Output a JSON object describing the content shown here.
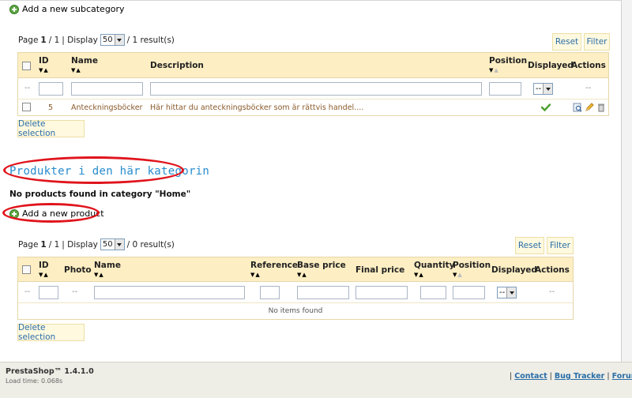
{
  "subcategory": {
    "add_link": "Add a new subcategory",
    "pager": {
      "page_label": "Page",
      "page": "1",
      "of": "/ 1",
      "display_label": "| Display",
      "per_page": "50",
      "results": "/ 1 result(s)"
    },
    "buttons": {
      "reset": "Reset",
      "filter": "Filter",
      "delete": "Delete selection"
    },
    "columns": {
      "id": "ID",
      "name": "Name",
      "description": "Description",
      "position": "Position",
      "displayed": "Displayed",
      "actions": "Actions"
    },
    "filter": {
      "dash": "--",
      "displayed_select": "--"
    },
    "rows": [
      {
        "id": "5",
        "name": "Anteckningsböcker",
        "description": "Här hittar du anteckningsböcker som är rättvis handel...."
      }
    ]
  },
  "products": {
    "section_title": "Produkter i den här kategorin",
    "empty_message": "No products found in category \"Home\"",
    "add_link": "Add a new product",
    "pager": {
      "page_label": "Page",
      "page": "1",
      "of": "/ 1",
      "display_label": "| Display",
      "per_page": "50",
      "results": "/ 0 result(s)"
    },
    "buttons": {
      "reset": "Reset",
      "filter": "Filter",
      "delete": "Delete selection"
    },
    "columns": {
      "id": "ID",
      "photo": "Photo",
      "name": "Name",
      "reference": "Reference",
      "base_price": "Base price",
      "final_price": "Final price",
      "quantity": "Quantity",
      "position": "Position",
      "displayed": "Displayed",
      "actions": "Actions"
    },
    "filter": {
      "dash": "--",
      "displayed_select": "--"
    },
    "no_items": "No items found"
  },
  "footer": {
    "brand": "PrestaShop™ 1.4.1.0",
    "load_time": "Load time: 0.068s",
    "separator": "|",
    "links": [
      "Contact",
      "Bug Tracker",
      "Forum"
    ]
  },
  "colors": {
    "annotation_red": "#e0141c",
    "title_blue": "#268ccd",
    "header_bg": "#fdeec3",
    "button_bg": "#fff9e0"
  }
}
